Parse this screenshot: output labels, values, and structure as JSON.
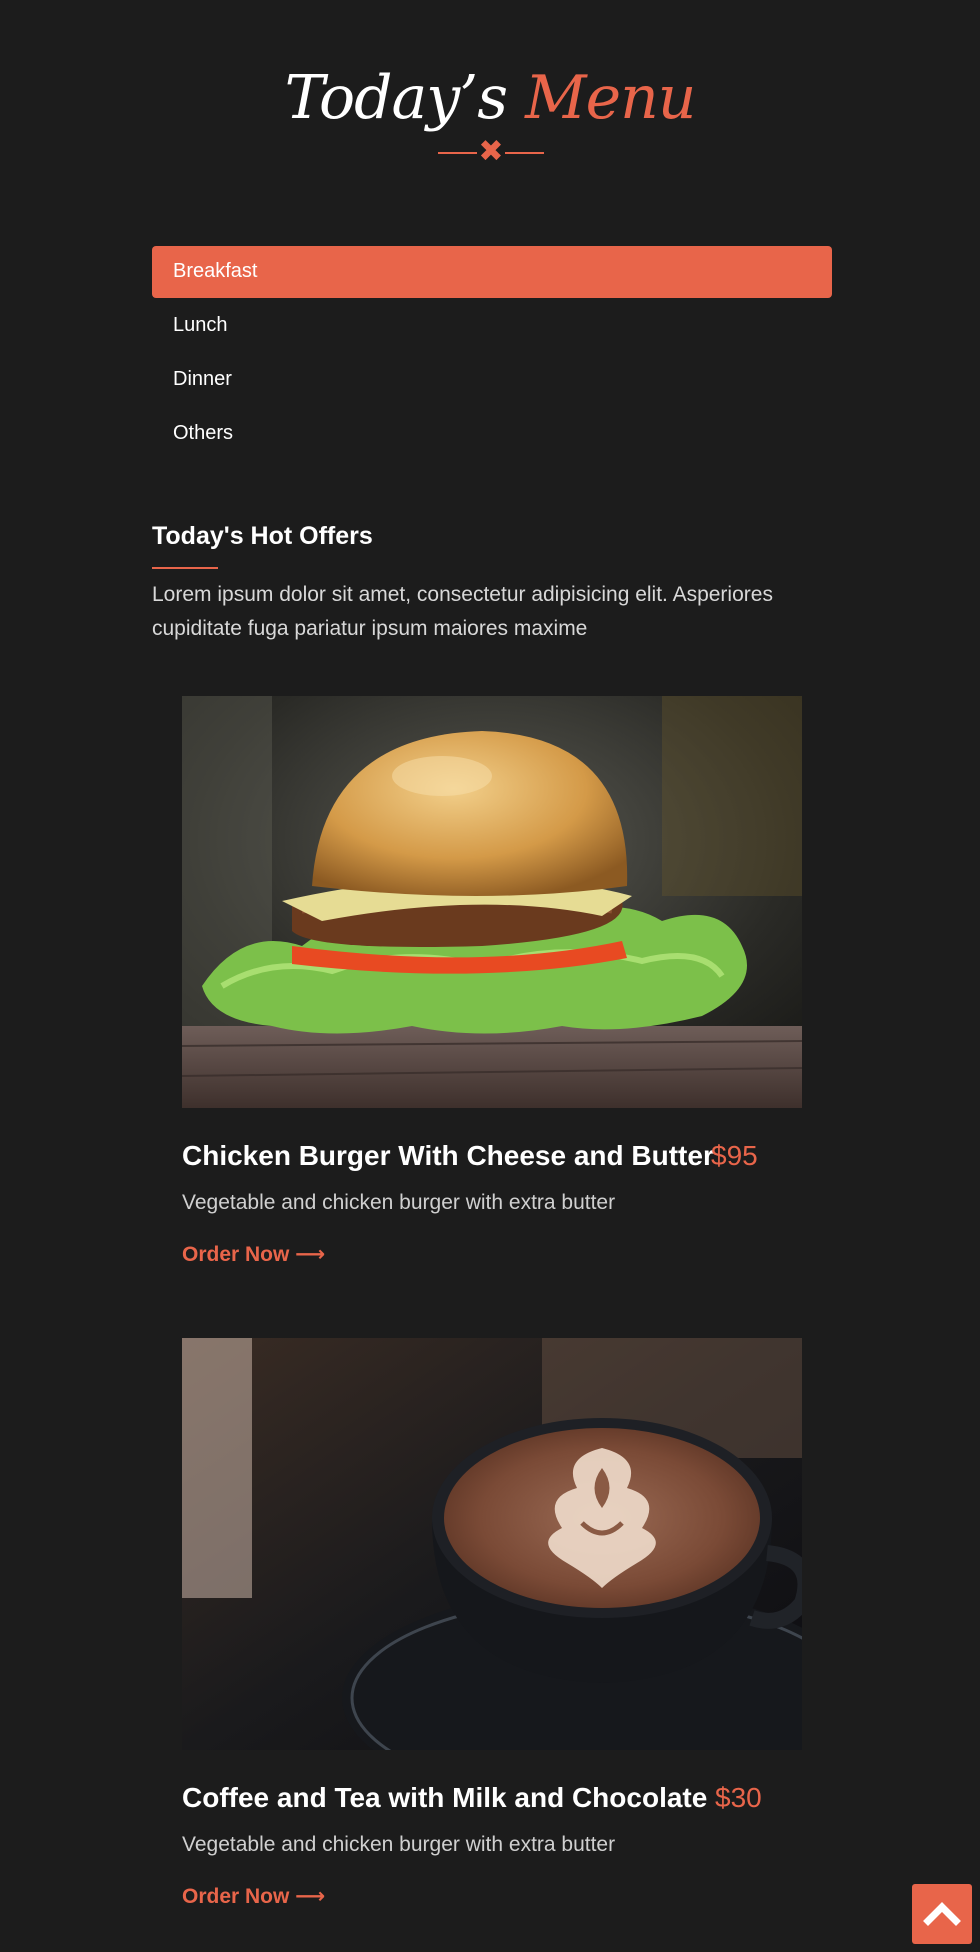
{
  "header": {
    "title_part1": "Today’s",
    "title_part2": "Menu",
    "divider_icon": "cross-icon"
  },
  "tabs": [
    {
      "label": "Breakfast",
      "active": true
    },
    {
      "label": "Lunch",
      "active": false
    },
    {
      "label": "Dinner",
      "active": false
    },
    {
      "label": "Others",
      "active": false
    }
  ],
  "offers": {
    "title": "Today's Hot Offers",
    "intro": "Lorem ipsum dolor sit amet, consectetur adipisicing elit. Asperiores cupiditate fuga pariatur ipsum maiores maxime"
  },
  "items": [
    {
      "name": "Chicken Burger With Cheese and Butter",
      "price": "$95",
      "description": "Vegetable and chicken burger with extra butter",
      "order_label": "Order Now ⟶",
      "image": "burger-photo"
    },
    {
      "name": "Coffee and Tea with Milk and Chocolate",
      "price": "$30",
      "description": "Vegetable and chicken burger with extra butter",
      "order_label": "Order Now ⟶",
      "image": "coffee-photo"
    }
  ],
  "colors": {
    "accent": "#e8654a",
    "background": "#1c1c1c"
  },
  "scroll_top": {
    "icon": "chevron-up-icon"
  }
}
